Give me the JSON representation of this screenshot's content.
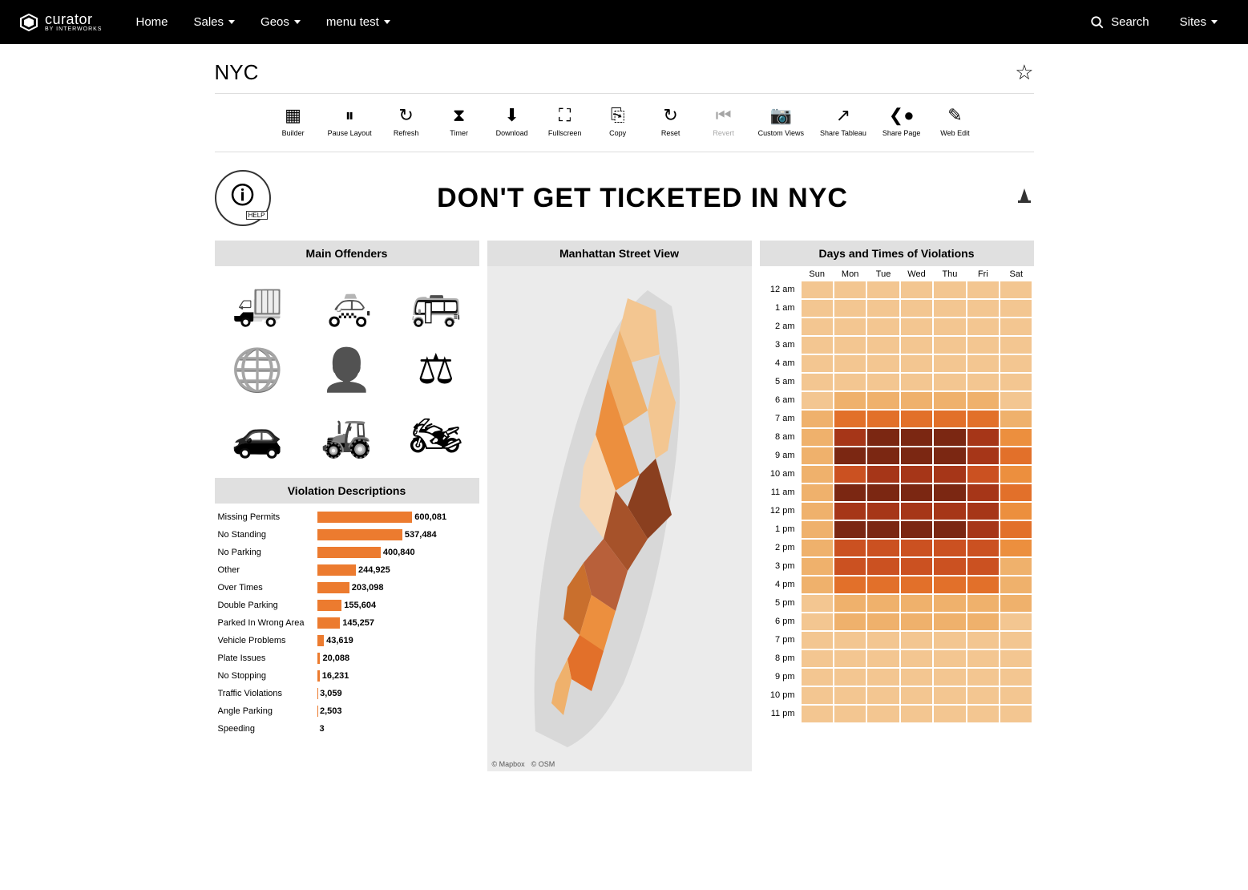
{
  "nav": {
    "brand": "curator",
    "brand_sub": "BY INTERWORKS",
    "links": [
      {
        "label": "Home",
        "dropdown": false
      },
      {
        "label": "Sales",
        "dropdown": true
      },
      {
        "label": "Geos",
        "dropdown": true
      },
      {
        "label": "menu test",
        "dropdown": true
      }
    ],
    "search_label": "Search",
    "sites_label": "Sites"
  },
  "page": {
    "title": "NYC"
  },
  "toolbar": [
    {
      "name": "builder",
      "label": "Builder",
      "icon": "▦"
    },
    {
      "name": "pause-layout",
      "label": "Pause Layout",
      "icon": "⏸"
    },
    {
      "name": "refresh",
      "label": "Refresh",
      "icon": "↻"
    },
    {
      "name": "timer",
      "label": "Timer",
      "icon": "⧗"
    },
    {
      "name": "download",
      "label": "Download",
      "icon": "⬇"
    },
    {
      "name": "fullscreen",
      "label": "Fullscreen",
      "icon": "⛶"
    },
    {
      "name": "copy",
      "label": "Copy",
      "icon": "⎘"
    },
    {
      "name": "reset",
      "label": "Reset",
      "icon": "↻"
    },
    {
      "name": "revert",
      "label": "Revert",
      "icon": "⏮",
      "disabled": true
    },
    {
      "name": "custom-views",
      "label": "Custom Views",
      "icon": "📷"
    },
    {
      "name": "share-tableau",
      "label": "Share Tableau",
      "icon": "↗"
    },
    {
      "name": "share-page",
      "label": "Share Page",
      "icon": "❮●"
    },
    {
      "name": "web-edit",
      "label": "Web Edit",
      "icon": "✎"
    }
  ],
  "dashboard": {
    "headline": "DON'T GET TICKETED IN NYC",
    "help_label": "HELP",
    "panels": {
      "offenders_title": "Main Offenders",
      "violations_title": "Violation Descriptions",
      "map_title": "Manhattan Street View",
      "heat_title": "Days and Times of Violations"
    },
    "offenders": [
      {
        "name": "truck",
        "glyph": "🚚"
      },
      {
        "name": "taxi",
        "glyph": "🚕"
      },
      {
        "name": "bus",
        "glyph": "🚌"
      },
      {
        "name": "globe",
        "glyph": "🌐"
      },
      {
        "name": "official",
        "glyph": "👤"
      },
      {
        "name": "gavel",
        "glyph": "⚖"
      },
      {
        "name": "car",
        "glyph": "🚗"
      },
      {
        "name": "tractor",
        "glyph": "🚜"
      },
      {
        "name": "motorcycle",
        "glyph": "🏍"
      }
    ],
    "map_attr": [
      "© Mapbox",
      "© OSM"
    ],
    "heat_days": [
      "Sun",
      "Mon",
      "Tue",
      "Wed",
      "Thu",
      "Fri",
      "Sat"
    ],
    "heat_hours": [
      "12 am",
      "1 am",
      "2 am",
      "3 am",
      "4 am",
      "5 am",
      "6 am",
      "7 am",
      "8 am",
      "9 am",
      "10 am",
      "11 am",
      "12 pm",
      "1 pm",
      "2 pm",
      "3 pm",
      "4 pm",
      "5 pm",
      "6 pm",
      "7 pm",
      "8 pm",
      "9 pm",
      "10 pm",
      "11 pm"
    ]
  },
  "chart_data": [
    {
      "type": "bar",
      "title": "Violation Descriptions",
      "xlabel": "",
      "ylabel": "",
      "orientation": "horizontal",
      "categories": [
        "Missing Permits",
        "No Standing",
        "No Parking",
        "Other",
        "Over Times",
        "Double Parking",
        "Parked In Wrong Area",
        "Vehicle Problems",
        "Plate Issues",
        "No Stopping",
        "Traffic Violations",
        "Angle Parking",
        "Speeding"
      ],
      "values": [
        600081,
        537484,
        400840,
        244925,
        203098,
        155604,
        145257,
        43619,
        20088,
        16231,
        3059,
        2503,
        3
      ],
      "value_labels": [
        "600,081",
        "537,484",
        "400,840",
        "244,925",
        "203,098",
        "155,604",
        "145,257",
        "43,619",
        "20,088",
        "16,231",
        "3,059",
        "2,503",
        "3"
      ],
      "color": "#ec7b2f"
    },
    {
      "type": "heatmap",
      "title": "Days and Times of Violations",
      "x": [
        "Sun",
        "Mon",
        "Tue",
        "Wed",
        "Thu",
        "Fri",
        "Sat"
      ],
      "y": [
        "12 am",
        "1 am",
        "2 am",
        "3 am",
        "4 am",
        "5 am",
        "6 am",
        "7 am",
        "8 am",
        "9 am",
        "10 am",
        "11 am",
        "12 pm",
        "1 pm",
        "2 pm",
        "3 pm",
        "4 pm",
        "5 pm",
        "6 pm",
        "7 pm",
        "8 pm",
        "9 pm",
        "10 pm",
        "11 pm"
      ],
      "z_comment": "relative intensity 0-9 (estimated from color)",
      "z": [
        [
          1,
          1,
          1,
          1,
          1,
          1,
          1
        ],
        [
          1,
          1,
          1,
          1,
          1,
          1,
          1
        ],
        [
          1,
          1,
          1,
          1,
          1,
          1,
          1
        ],
        [
          1,
          1,
          1,
          1,
          1,
          1,
          1
        ],
        [
          1,
          1,
          1,
          1,
          1,
          1,
          1
        ],
        [
          1,
          1,
          1,
          1,
          1,
          1,
          1
        ],
        [
          1,
          2,
          2,
          2,
          2,
          2,
          1
        ],
        [
          2,
          5,
          5,
          5,
          5,
          5,
          3
        ],
        [
          2,
          8,
          9,
          9,
          9,
          8,
          4
        ],
        [
          2,
          9,
          9,
          9,
          9,
          8,
          5
        ],
        [
          2,
          7,
          8,
          8,
          8,
          7,
          4
        ],
        [
          2,
          9,
          9,
          9,
          9,
          8,
          5
        ],
        [
          2,
          8,
          8,
          8,
          8,
          8,
          4
        ],
        [
          2,
          9,
          9,
          9,
          9,
          8,
          5
        ],
        [
          2,
          7,
          7,
          7,
          7,
          7,
          4
        ],
        [
          2,
          6,
          6,
          6,
          6,
          6,
          3
        ],
        [
          2,
          5,
          5,
          5,
          5,
          5,
          3
        ],
        [
          1,
          3,
          3,
          3,
          3,
          3,
          2
        ],
        [
          1,
          2,
          2,
          2,
          2,
          2,
          1
        ],
        [
          1,
          1,
          1,
          1,
          1,
          1,
          1
        ],
        [
          1,
          1,
          1,
          1,
          1,
          1,
          1
        ],
        [
          1,
          1,
          1,
          1,
          1,
          1,
          1
        ],
        [
          1,
          1,
          1,
          1,
          1,
          1,
          1
        ],
        [
          1,
          1,
          1,
          1,
          1,
          1,
          1
        ]
      ],
      "colorscale": [
        "#f6d7b4",
        "#f3c691",
        "#efb16c",
        "#ec8f3e",
        "#e2702a",
        "#cb5121",
        "#a63618",
        "#7b2712"
      ]
    }
  ]
}
